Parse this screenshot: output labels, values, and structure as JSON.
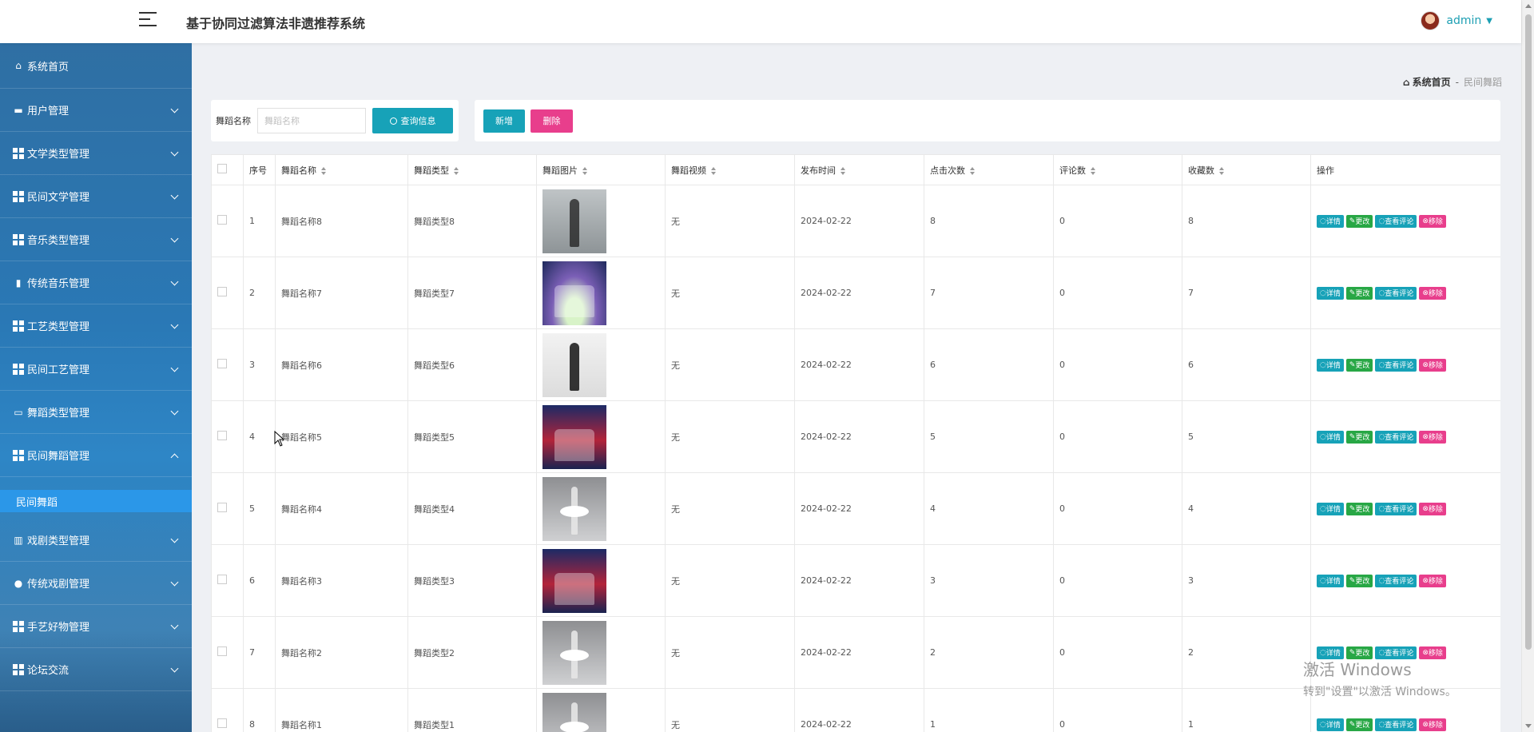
{
  "app": {
    "title": "基于协同过滤算法非遗推荐系统"
  },
  "user": {
    "name": "admin"
  },
  "sidebar": {
    "items": [
      {
        "label": "系统首页",
        "icon": "home-icon"
      },
      {
        "label": "用户管理",
        "icon": "briefcase-icon"
      },
      {
        "label": "文学类型管理",
        "icon": "grid-icon"
      },
      {
        "label": "民间文学管理",
        "icon": "grid-icon"
      },
      {
        "label": "音乐类型管理",
        "icon": "grid-icon"
      },
      {
        "label": "传统音乐管理",
        "icon": "clipboard-icon"
      },
      {
        "label": "工艺类型管理",
        "icon": "grid-icon"
      },
      {
        "label": "民间工艺管理",
        "icon": "grid-icon"
      },
      {
        "label": "舞蹈类型管理",
        "icon": "monitor-icon"
      },
      {
        "label": "民间舞蹈管理",
        "icon": "grid-icon",
        "expanded": true
      },
      {
        "label": "戏剧类型管理",
        "icon": "book-icon"
      },
      {
        "label": "传统戏剧管理",
        "icon": "bulb-icon"
      },
      {
        "label": "手艺好物管理",
        "icon": "grid-icon"
      },
      {
        "label": "论坛交流",
        "icon": "grid-icon"
      }
    ],
    "sub_active": "民间舞蹈"
  },
  "breadcrumb": {
    "home": "系统首页",
    "sep": "-",
    "current": "民间舞蹈"
  },
  "search": {
    "label": "舞蹈名称",
    "placeholder": "舞蹈名称",
    "button": "查询信息"
  },
  "actions": {
    "add": "新增",
    "delete": "删除"
  },
  "table": {
    "headers": [
      "序号",
      "舞蹈名称",
      "舞蹈类型",
      "舞蹈图片",
      "舞蹈视频",
      "发布时间",
      "点击次数",
      "评论数",
      "收藏数",
      "操作"
    ],
    "row_buttons": {
      "detail": "详情",
      "edit": "更改",
      "comments": "查看评论",
      "remove": "移除"
    },
    "rows": [
      {
        "idx": "1",
        "name": "舞蹈名称8",
        "type": "舞蹈类型8",
        "img": "gray",
        "video": "无",
        "date": "2024-02-22",
        "clicks": "8",
        "comments": "0",
        "favs": "8"
      },
      {
        "idx": "2",
        "name": "舞蹈名称7",
        "type": "舞蹈类型7",
        "img": "stage",
        "video": "无",
        "date": "2024-02-22",
        "clicks": "7",
        "comments": "0",
        "favs": "7"
      },
      {
        "idx": "3",
        "name": "舞蹈名称6",
        "type": "舞蹈类型6",
        "img": "white",
        "video": "无",
        "date": "2024-02-22",
        "clicks": "6",
        "comments": "0",
        "favs": "6"
      },
      {
        "idx": "4",
        "name": "舞蹈名称5",
        "type": "舞蹈类型5",
        "img": "red",
        "video": "无",
        "date": "2024-02-22",
        "clicks": "5",
        "comments": "0",
        "favs": "5"
      },
      {
        "idx": "5",
        "name": "舞蹈名称4",
        "type": "舞蹈类型4",
        "img": "ballet",
        "video": "无",
        "date": "2024-02-22",
        "clicks": "4",
        "comments": "0",
        "favs": "4"
      },
      {
        "idx": "6",
        "name": "舞蹈名称3",
        "type": "舞蹈类型3",
        "img": "red",
        "video": "无",
        "date": "2024-02-22",
        "clicks": "3",
        "comments": "0",
        "favs": "3"
      },
      {
        "idx": "7",
        "name": "舞蹈名称2",
        "type": "舞蹈类型2",
        "img": "ballet",
        "video": "无",
        "date": "2024-02-22",
        "clicks": "2",
        "comments": "0",
        "favs": "2"
      },
      {
        "idx": "8",
        "name": "舞蹈名称1",
        "type": "舞蹈类型1",
        "img": "ballet",
        "video": "无",
        "date": "2024-02-22",
        "clicks": "1",
        "comments": "0",
        "favs": "1"
      }
    ]
  },
  "watermark": {
    "line1": "激活 Windows",
    "line2": "转到\"设置\"以激活 Windows。"
  },
  "colors": {
    "accent": "#17a2b8",
    "danger": "#e83e8c",
    "success": "#28a745",
    "sidebar": "#2a78b5",
    "active_sub": "#2b97e8"
  }
}
